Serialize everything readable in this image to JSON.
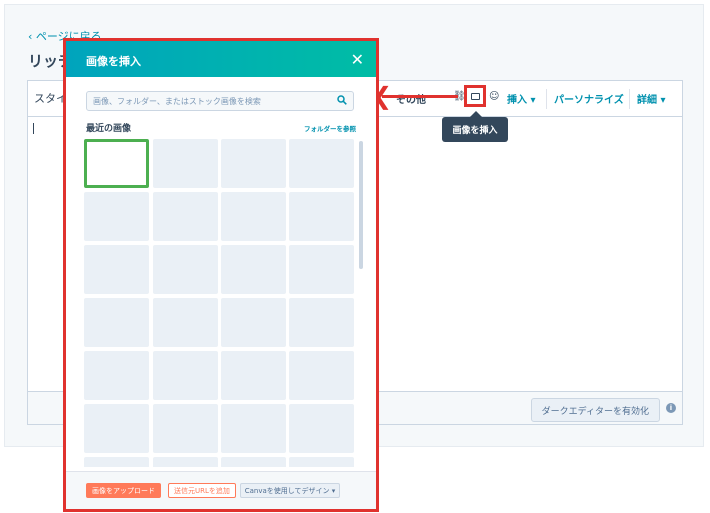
{
  "background": {
    "back_link": "‹  ページに戻る",
    "page_title": "リッチテキスト",
    "toolbar": {
      "style": "スタイル",
      "more": "その他",
      "insert": "挿入 ▾",
      "personalize": "パーソナライズ",
      "details": "詳細 ▾"
    },
    "tooltip": "画像を挿入",
    "dark_editor_button": "ダークエディターを有効化",
    "info": "i"
  },
  "modal": {
    "title": "画像を挿入",
    "close": "✕",
    "search_placeholder": "画像、フォルダー、またはストック画像を検索",
    "recent_label": "最近の画像",
    "browse_folder_link": "フォルダーを参照",
    "footer": {
      "upload": "画像をアップロード",
      "add_url": "送信元URLを追加",
      "canva": "Canvaを使用してデザイン ▾"
    }
  },
  "colors": {
    "accent_red": "#e0322e",
    "header_start": "#00a4bd",
    "header_end": "#00bda5",
    "selected_green": "#4caf50",
    "primary_orange": "#ff7a59"
  }
}
